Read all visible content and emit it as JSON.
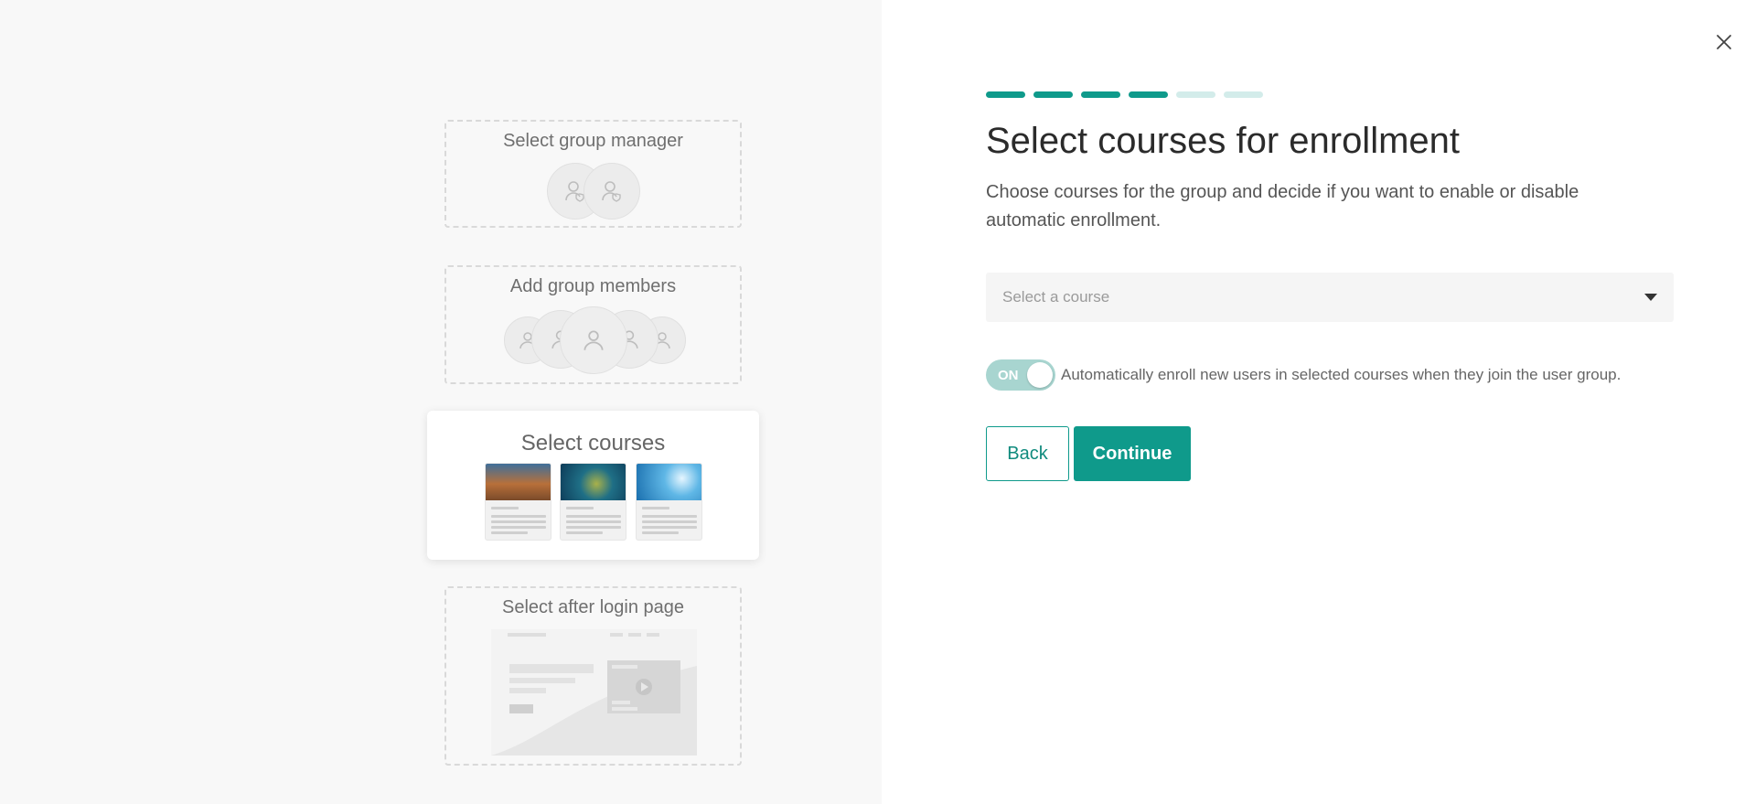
{
  "colors": {
    "accent": "#0f9a8b",
    "accent_light": "#d3ecea",
    "left_bg": "#f8f8f8"
  },
  "steps": [
    {
      "title": "Select group manager",
      "state": "pending",
      "illustration": "manager-avatars"
    },
    {
      "title": "Add group members",
      "state": "pending",
      "illustration": "member-avatars"
    },
    {
      "title": "Select courses",
      "state": "active",
      "illustration": "course-thumbnails"
    },
    {
      "title": "Select after login page",
      "state": "pending",
      "illustration": "login-page-preview"
    }
  ],
  "progress": {
    "total": 6,
    "completed": 4
  },
  "main": {
    "title": "Select courses for enrollment",
    "description": "Choose courses for the group and decide if you want to enable or disable automatic enrollment.",
    "course_select": {
      "placeholder": "Select a course"
    },
    "auto_enroll": {
      "state_label": "ON",
      "enabled": true,
      "label": "Automatically enroll new users in selected courses when they join the user group."
    },
    "buttons": {
      "back": "Back",
      "continue": "Continue"
    }
  },
  "icons": {
    "close": "close-icon",
    "dropdown": "caret-down-icon"
  }
}
